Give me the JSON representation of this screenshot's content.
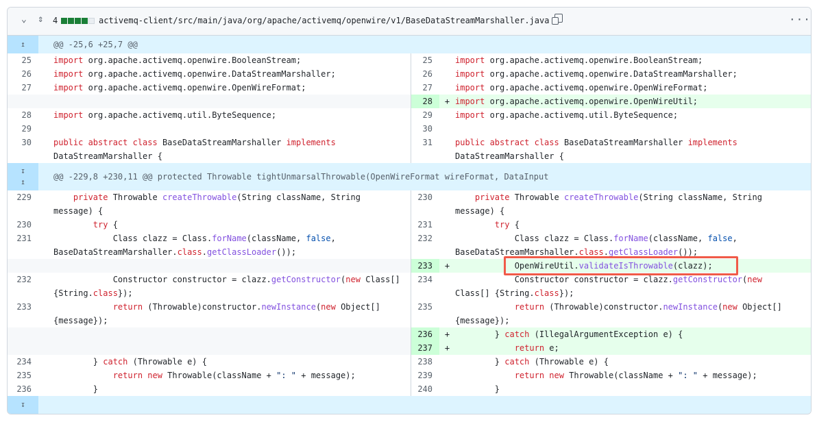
{
  "file": {
    "changes": "4",
    "path": "activemq-client/src/main/java/org/apache/activemq/openwire/v1/BaseDataStreamMarshaller.java",
    "bars": [
      "#1a7f37",
      "#1a7f37",
      "#1a7f37",
      "#1a7f37",
      "#eaeef2"
    ],
    "icons": [
      "chevron-down-icon",
      "unfold-icon",
      "copy-icon",
      "kebab-icon"
    ]
  },
  "rows": [
    {
      "hunk": "@@ -25,6 +25,7 @@",
      "expand": "up"
    },
    {
      "l": {
        "n": "25",
        "code": [
          [
            "k",
            "import"
          ],
          [
            "p",
            " org.apache.activemq.openwire.BooleanStream;"
          ]
        ]
      },
      "r": {
        "n": "25",
        "code": [
          [
            "k",
            "import"
          ],
          [
            "p",
            " org.apache.activemq.openwire.BooleanStream;"
          ]
        ]
      }
    },
    {
      "l": {
        "n": "26",
        "code": [
          [
            "k",
            "import"
          ],
          [
            "p",
            " org.apache.activemq.openwire.DataStreamMarshaller;"
          ]
        ]
      },
      "r": {
        "n": "26",
        "code": [
          [
            "k",
            "import"
          ],
          [
            "p",
            " org.apache.activemq.openwire.DataStreamMarshaller;"
          ]
        ]
      }
    },
    {
      "l": {
        "n": "27",
        "code": [
          [
            "k",
            "import"
          ],
          [
            "p",
            " org.apache.activemq.openwire.OpenWireFormat;"
          ]
        ]
      },
      "r": {
        "n": "27",
        "code": [
          [
            "k",
            "import"
          ],
          [
            "p",
            " org.apache.activemq.openwire.OpenWireFormat;"
          ]
        ]
      }
    },
    {
      "add": true,
      "r": {
        "n": "28",
        "mark": "+",
        "code": [
          [
            "k",
            "import"
          ],
          [
            "p",
            " org.apache.activemq.openwire.OpenWireUtil;"
          ]
        ]
      }
    },
    {
      "l": {
        "n": "28",
        "code": [
          [
            "k",
            "import"
          ],
          [
            "p",
            " org.apache.activemq.util.ByteSequence;"
          ]
        ]
      },
      "r": {
        "n": "29",
        "code": [
          [
            "k",
            "import"
          ],
          [
            "p",
            " org.apache.activemq.util.ByteSequence;"
          ]
        ]
      }
    },
    {
      "l": {
        "n": "29",
        "code": []
      },
      "r": {
        "n": "30",
        "code": []
      }
    },
    {
      "l": {
        "n": "30",
        "code": [
          [
            "k",
            "public abstract class"
          ],
          [
            "p",
            " BaseDataStreamMarshaller "
          ],
          [
            "k",
            "implements"
          ],
          [
            "p",
            " DataStreamMarshaller {"
          ]
        ]
      },
      "r": {
        "n": "31",
        "code": [
          [
            "k",
            "public abstract class"
          ],
          [
            "p",
            " BaseDataStreamMarshaller "
          ],
          [
            "k",
            "implements"
          ],
          [
            "p",
            " DataStreamMarshaller {"
          ]
        ]
      }
    },
    {
      "hunk": "@@ -229,8 +230,11 @@ protected Throwable tightUnmarsalThrowable(OpenWireFormat wireFormat, DataInput",
      "expand": "both"
    },
    {
      "l": {
        "n": "229",
        "code": [
          [
            "p",
            "    "
          ],
          [
            "k",
            "private"
          ],
          [
            "p",
            " Throwable "
          ],
          [
            "f",
            "createThrowable"
          ],
          [
            "p",
            "(String className, String message) {"
          ]
        ]
      },
      "r": {
        "n": "230",
        "code": [
          [
            "p",
            "    "
          ],
          [
            "k",
            "private"
          ],
          [
            "p",
            " Throwable "
          ],
          [
            "f",
            "createThrowable"
          ],
          [
            "p",
            "(String className, String message) {"
          ]
        ]
      }
    },
    {
      "l": {
        "n": "230",
        "code": [
          [
            "p",
            "        "
          ],
          [
            "k",
            "try"
          ],
          [
            "p",
            " {"
          ]
        ]
      },
      "r": {
        "n": "231",
        "code": [
          [
            "p",
            "        "
          ],
          [
            "k",
            "try"
          ],
          [
            "p",
            " {"
          ]
        ]
      }
    },
    {
      "l": {
        "n": "231",
        "code": [
          [
            "p",
            "            Class clazz = Class."
          ],
          [
            "f",
            "forName"
          ],
          [
            "p",
            "(className, "
          ],
          [
            "c",
            "false"
          ],
          [
            "p",
            ", BaseDataStreamMarshaller."
          ],
          [
            "k",
            "class"
          ],
          [
            "p",
            "."
          ],
          [
            "f",
            "getClassLoader"
          ],
          [
            "p",
            "());"
          ]
        ]
      },
      "r": {
        "n": "232",
        "code": [
          [
            "p",
            "            Class clazz = Class."
          ],
          [
            "f",
            "forName"
          ],
          [
            "p",
            "(className, "
          ],
          [
            "c",
            "false"
          ],
          [
            "p",
            ", BaseDataStreamMarshaller."
          ],
          [
            "k",
            "class"
          ],
          [
            "p",
            "."
          ],
          [
            "f",
            "getClassLoader"
          ],
          [
            "p",
            "());"
          ]
        ]
      }
    },
    {
      "add": true,
      "r": {
        "n": "233",
        "mark": "+",
        "code": [
          [
            "p",
            "            OpenWireUtil."
          ],
          [
            "f",
            "validateIsThrowable"
          ],
          [
            "p",
            "(clazz);"
          ]
        ]
      }
    },
    {
      "l": {
        "n": "232",
        "code": [
          [
            "p",
            "            Constructor constructor = clazz."
          ],
          [
            "f",
            "getConstructor"
          ],
          [
            "p",
            "("
          ],
          [
            "k",
            "new"
          ],
          [
            "p",
            " Class[] {String."
          ],
          [
            "k",
            "class"
          ],
          [
            "p",
            "});"
          ]
        ]
      },
      "r": {
        "n": "234",
        "code": [
          [
            "p",
            "            Constructor constructor = clazz."
          ],
          [
            "f",
            "getConstructor"
          ],
          [
            "p",
            "("
          ],
          [
            "k",
            "new"
          ],
          [
            "p",
            " Class[] {String."
          ],
          [
            "k",
            "class"
          ],
          [
            "p",
            "});"
          ]
        ]
      }
    },
    {
      "l": {
        "n": "233",
        "code": [
          [
            "p",
            "            "
          ],
          [
            "k",
            "return"
          ],
          [
            "p",
            " (Throwable)constructor."
          ],
          [
            "f",
            "newInstance"
          ],
          [
            "p",
            "("
          ],
          [
            "k",
            "new"
          ],
          [
            "p",
            " Object[] {message});"
          ]
        ]
      },
      "r": {
        "n": "235",
        "code": [
          [
            "p",
            "            "
          ],
          [
            "k",
            "return"
          ],
          [
            "p",
            " (Throwable)constructor."
          ],
          [
            "f",
            "newInstance"
          ],
          [
            "p",
            "("
          ],
          [
            "k",
            "new"
          ],
          [
            "p",
            " Object[] {message});"
          ]
        ]
      }
    },
    {
      "add": true,
      "r": {
        "n": "236",
        "mark": "+",
        "code": [
          [
            "p",
            "        } "
          ],
          [
            "k",
            "catch"
          ],
          [
            "p",
            " (IllegalArgumentException e) {"
          ]
        ]
      }
    },
    {
      "add": true,
      "r": {
        "n": "237",
        "mark": "+",
        "code": [
          [
            "p",
            "            "
          ],
          [
            "k",
            "return"
          ],
          [
            "p",
            " e;"
          ]
        ]
      }
    },
    {
      "l": {
        "n": "234",
        "code": [
          [
            "p",
            "        } "
          ],
          [
            "k",
            "catch"
          ],
          [
            "p",
            " (Throwable e) {"
          ]
        ]
      },
      "r": {
        "n": "238",
        "code": [
          [
            "p",
            "        } "
          ],
          [
            "k",
            "catch"
          ],
          [
            "p",
            " (Throwable e) {"
          ]
        ]
      }
    },
    {
      "l": {
        "n": "235",
        "code": [
          [
            "p",
            "            "
          ],
          [
            "k",
            "return new"
          ],
          [
            "p",
            " Throwable(className + "
          ],
          [
            "s",
            "\": \""
          ],
          [
            "p",
            " + message);"
          ]
        ]
      },
      "r": {
        "n": "239",
        "code": [
          [
            "p",
            "            "
          ],
          [
            "k",
            "return new"
          ],
          [
            "p",
            " Throwable(className + "
          ],
          [
            "s",
            "\": \""
          ],
          [
            "p",
            " + message);"
          ]
        ]
      }
    },
    {
      "l": {
        "n": "236",
        "code": [
          [
            "p",
            "        }"
          ]
        ]
      },
      "r": {
        "n": "240",
        "code": [
          [
            "p",
            "        }"
          ]
        ]
      }
    },
    {
      "hunk": "",
      "expand": "down"
    }
  ]
}
